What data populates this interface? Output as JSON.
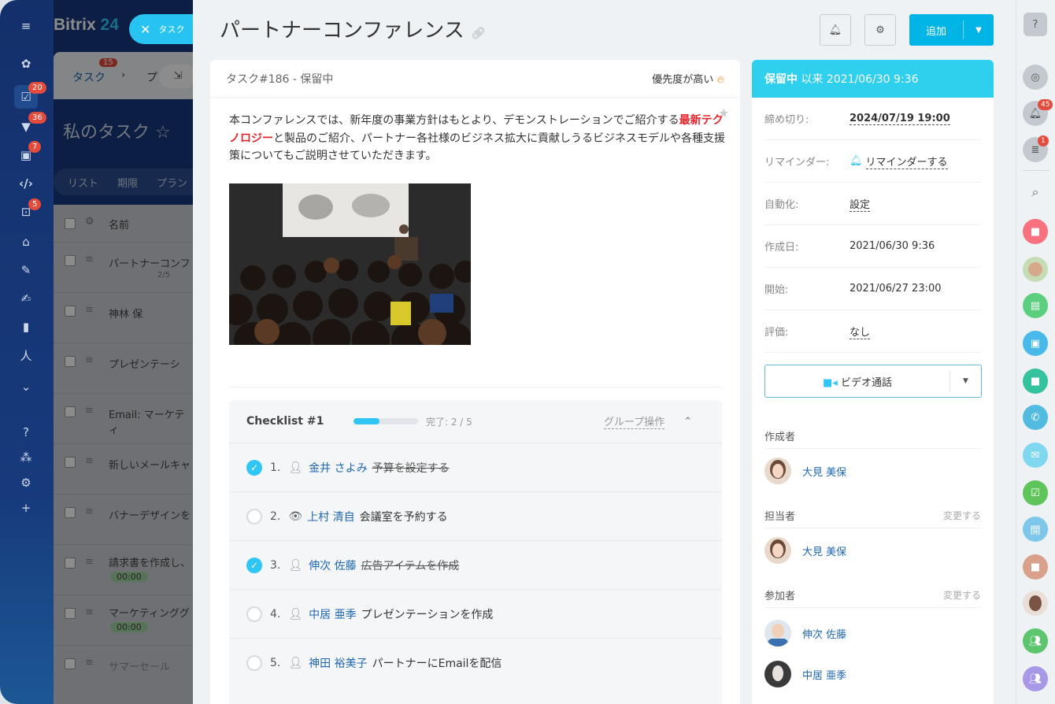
{
  "app": {
    "logo_text": "Bitrix",
    "logo_num": "24"
  },
  "leftbar": {
    "badges": [
      {
        "text": "20"
      },
      {
        "text": "36"
      },
      {
        "text": "7"
      },
      {
        "text": "5"
      }
    ]
  },
  "background_app": {
    "tab_label": "タスク",
    "tab_badge": "15",
    "tab_next": "プ",
    "page_title": "私のタスク",
    "view_tabs": [
      "リスト",
      "期限",
      "プラン"
    ],
    "column_name": "名前",
    "rows": [
      {
        "title": "パートナーコンフ",
        "meta": "2/5"
      },
      {
        "title": "神林 保"
      },
      {
        "title": "プレゼンテーシ"
      },
      {
        "title": "Email: マーケティ"
      },
      {
        "title": "新しいメールキャ"
      },
      {
        "title": "バナーデザインを"
      },
      {
        "title": "請求書を作成し、",
        "timer": "00:00"
      },
      {
        "title": "マーケティンググ",
        "timer": "00:00"
      },
      {
        "title": "サマーセール"
      }
    ]
  },
  "close_tab": {
    "label": "タスク"
  },
  "header": {
    "title": "パートナーコンファレンス",
    "add_label": "追加"
  },
  "task": {
    "id_status": "タスク#186 - 保留中",
    "priority": "優先度が高い",
    "desc_before": "本コンファレンスでは、新年度の事業方針はもとより、デモンストレーションでご紹介する",
    "desc_highlight": "最新テクノロジー",
    "desc_after": "と製品のご紹介、パートナー各社様のビジネス拡大に貢献しうるビジネスモデルや各種支援策についてもご説明させていただきます。"
  },
  "checklist": {
    "title": "Checklist #1",
    "progress": 0.4,
    "progress_text": "完了: 2 / 5",
    "group_action": "グループ操作",
    "items": [
      {
        "num": "1.",
        "person": "金井 さよみ",
        "text": "予算を設定する",
        "done": true,
        "icon": "user-icon"
      },
      {
        "num": "2.",
        "person": "上村 清自",
        "text": "会議室を予約する",
        "done": false,
        "icon": "eye-icon"
      },
      {
        "num": "3.",
        "person": "伸次 佐藤",
        "text": "広告アイテムを作成",
        "done": true,
        "icon": "user-icon"
      },
      {
        "num": "4.",
        "person": "中居 亜季",
        "text": "プレゼンテーションを作成",
        "done": false,
        "icon": "user-icon"
      },
      {
        "num": "5.",
        "person": "神田 裕美子",
        "text": "パートナーにEmailを配信",
        "done": false,
        "icon": "user-icon"
      }
    ]
  },
  "info": {
    "status_bold": "保留中",
    "status_rest": "以来 2021/06/30 9:36",
    "rows": [
      {
        "label": "締め切り:",
        "value": "2024/07/19 19:00"
      },
      {
        "label": "リマインダー:",
        "value": "リマインダーする"
      },
      {
        "label": "自動化:",
        "value": "設定"
      },
      {
        "label": "作成日:",
        "value": "2021/06/30 9:36"
      },
      {
        "label": "開始:",
        "value": "2021/06/27 23:00"
      },
      {
        "label": "評価:",
        "value": "なし"
      }
    ],
    "video_call": "ビデオ通話",
    "creator_label": "作成者",
    "creator": "大見 美保",
    "assignee_label": "担当者",
    "assignee_change": "変更する",
    "assignee": "大見 美保",
    "participants_label": "参加者",
    "participants_change": "変更する",
    "participants": [
      "伸次 佐藤",
      "中居 亜季"
    ]
  },
  "rightbar": {
    "badges": [
      {
        "text": "45"
      },
      {
        "text": "1"
      }
    ],
    "open_label": "開"
  },
  "colors": {
    "accent": "#00b4e6",
    "status": "#2fd0ee",
    "highlight": "#e3242b",
    "sidebar": "#14306b"
  }
}
